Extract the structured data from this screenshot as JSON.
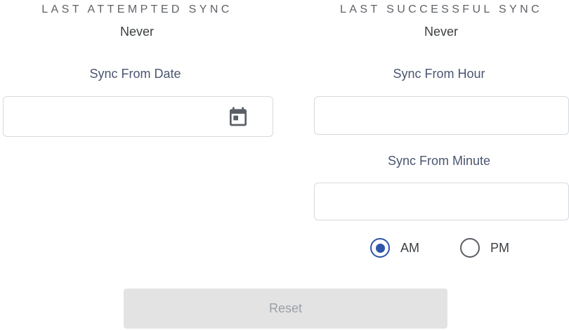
{
  "status": {
    "last_attempted": {
      "caption": "LAST ATTEMPTED SYNC",
      "value": "Never"
    },
    "last_successful": {
      "caption": "LAST SUCCESSFUL SYNC",
      "value": "Never"
    }
  },
  "form": {
    "sync_from_date": {
      "label": "Sync From Date",
      "value": "",
      "icon": "calendar-icon"
    },
    "sync_from_hour": {
      "label": "Sync From Hour",
      "value": ""
    },
    "sync_from_minute": {
      "label": "Sync From Minute",
      "value": ""
    },
    "meridiem": {
      "options": [
        {
          "label": "AM",
          "selected": true
        },
        {
          "label": "PM",
          "selected": false
        }
      ]
    },
    "reset_label": "Reset"
  },
  "colors": {
    "accent": "#2d56a8",
    "label_text": "#4a5670",
    "caption_text": "#5f6368",
    "input_border": "#d6d9de",
    "button_disabled_bg": "#e3e3e3",
    "button_disabled_text": "#9aa0a6"
  }
}
